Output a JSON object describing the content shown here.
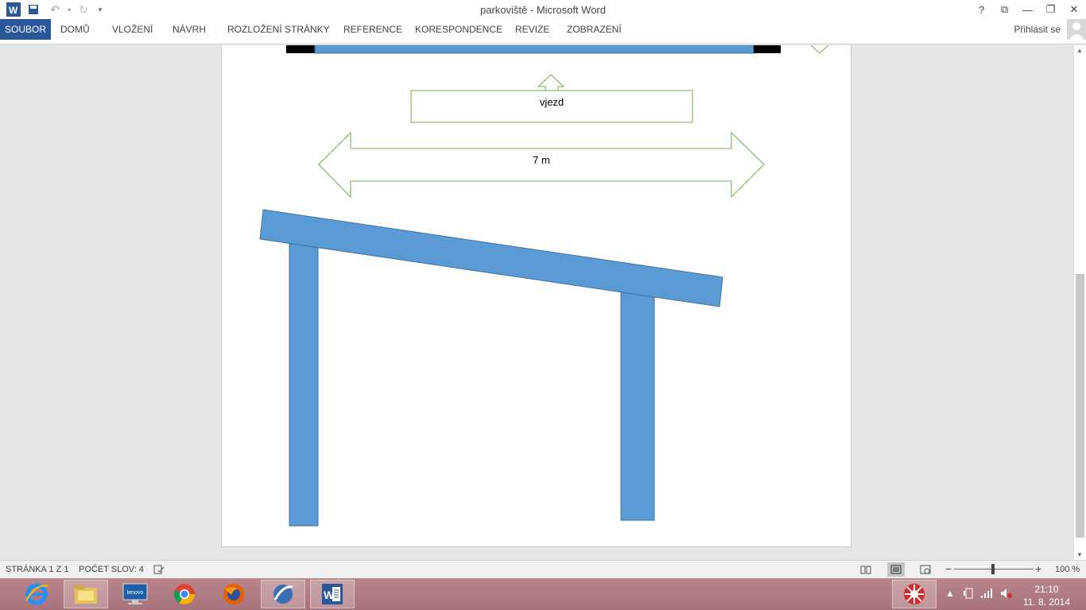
{
  "window": {
    "title": "parkoviště - Microsoft Word"
  },
  "window_controls": {
    "help": "?",
    "ribbon_opts": "⧉",
    "minimize": "—",
    "restore": "❐",
    "close": "✕"
  },
  "ribbon": {
    "tabs": [
      "SOUBOR",
      "DOMŮ",
      "VLOŽENÍ",
      "NÁVRH",
      "ROZLOŽENÍ STRÁNKY",
      "REFERENCE",
      "KORESPONDENCE",
      "REVIZE",
      "ZOBRAZENÍ"
    ],
    "signin": "Přihlásit se"
  },
  "document": {
    "shapes": {
      "vjezd_label": "vjezd",
      "width_label": "7 m"
    },
    "colors": {
      "beam": "#5b9bd5",
      "beam_stroke": "#41719c",
      "arrow_stroke": "#70ad47"
    }
  },
  "statusbar": {
    "page": "STRÁNKA 1 Z 1",
    "words": "POČET SLOV: 4",
    "zoom": "100 %"
  },
  "taskbar": {
    "apps": [
      "internet-explorer-icon",
      "file-explorer-icon",
      "lenovo-icon",
      "chrome-icon",
      "firefox-icon",
      "media-icon",
      "word-icon"
    ],
    "time": "21:10",
    "date": "11. 8. 2014"
  }
}
